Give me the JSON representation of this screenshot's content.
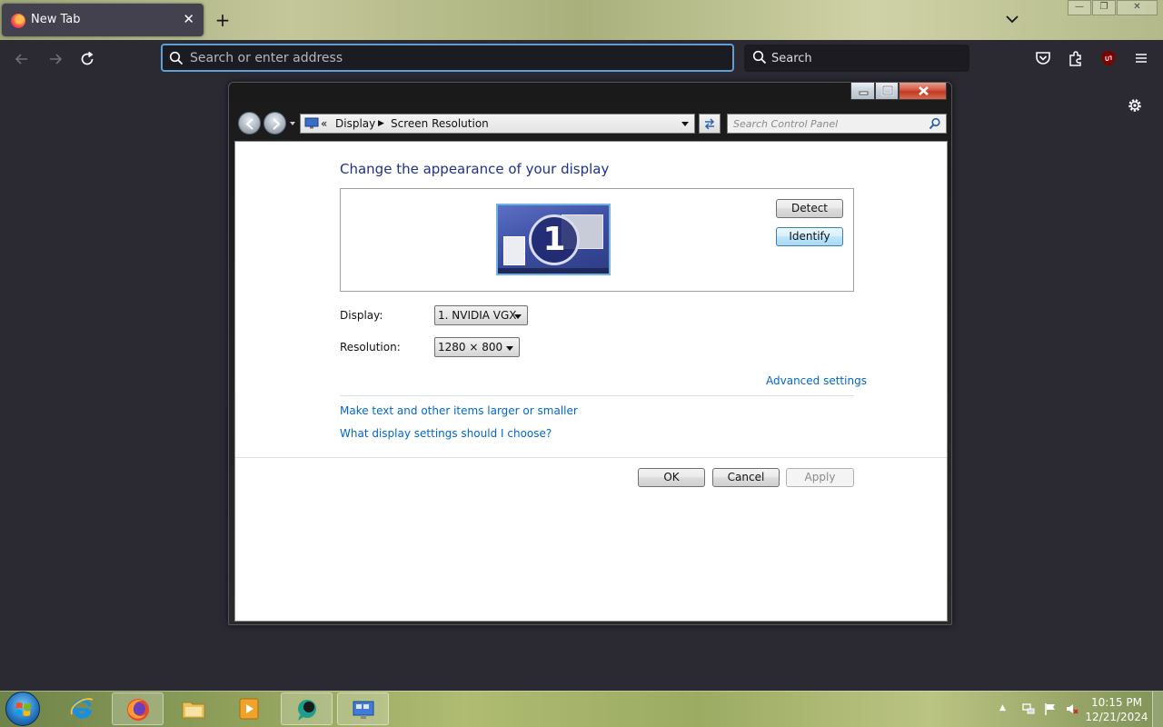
{
  "browser": {
    "tab": {
      "title": "New Tab",
      "close": "✕"
    },
    "new_tab": "+",
    "urlbar": {
      "placeholder": "Search or enter address"
    },
    "searchbar": {
      "placeholder": "Search"
    }
  },
  "window": {
    "breadcrumbs": {
      "overflow": "«",
      "items": [
        "Display",
        "Screen Resolution"
      ]
    },
    "search": {
      "placeholder": "Search Control Panel"
    },
    "heading": "Change the appearance of your display",
    "monitor_number": "1",
    "buttons": {
      "detect": "Detect",
      "identify": "Identify",
      "ok": "OK",
      "cancel": "Cancel",
      "apply": "Apply"
    },
    "display": {
      "label": "Display:",
      "value": "1. NVIDIA VGX"
    },
    "resolution": {
      "label": "Resolution:",
      "value": "1280 × 800"
    },
    "links": {
      "advanced": "Advanced settings",
      "text_size": "Make text and other items larger or smaller",
      "help": "What display settings should I choose?"
    }
  },
  "taskbar": {
    "clock": {
      "time": "10:15 PM",
      "date": "12/21/2024"
    }
  },
  "colors": {
    "accent_link": "#0066cc",
    "heading": "#1e3287",
    "urlbar_focus": "#5e9fd6"
  }
}
